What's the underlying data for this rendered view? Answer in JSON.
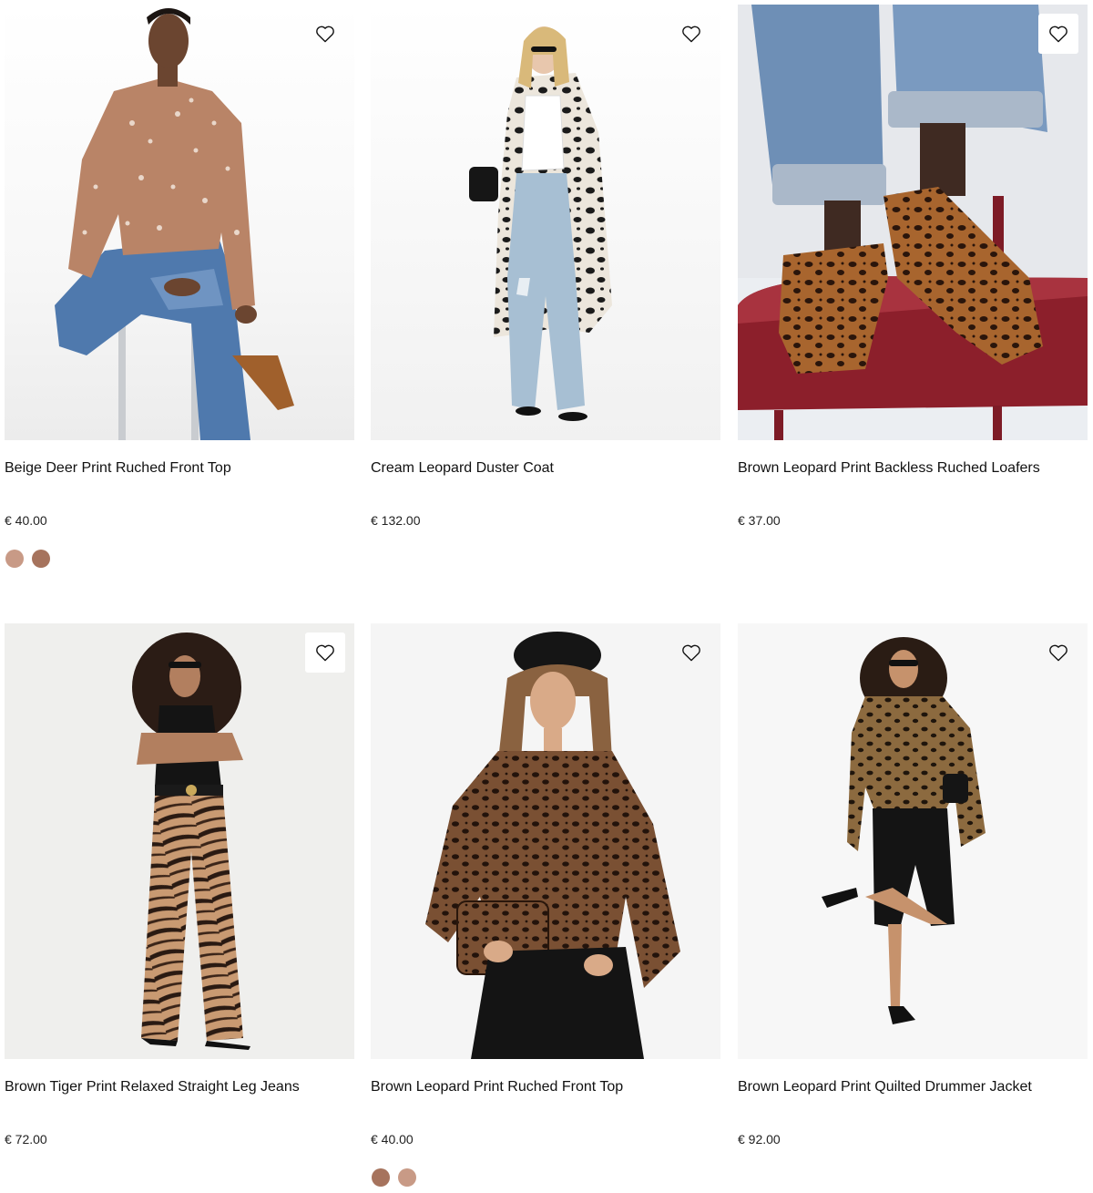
{
  "products": [
    {
      "title": "Beige Deer Print Ruched Front Top",
      "price": "€ 40.00",
      "swatches": [
        {
          "name": "swatch-light",
          "color": "#c89a86"
        },
        {
          "name": "swatch-dark",
          "color": "#a6735d"
        }
      ]
    },
    {
      "title": "Cream Leopard Duster Coat",
      "price": "€ 132.00",
      "swatches": []
    },
    {
      "title": "Brown Leopard Print Backless Ruched Loafers",
      "price": "€ 37.00",
      "swatches": []
    },
    {
      "title": "Brown Tiger Print Relaxed Straight Leg Jeans",
      "price": "€ 72.00",
      "swatches": []
    },
    {
      "title": "Brown Leopard Print Ruched Front Top",
      "price": "€ 40.00",
      "swatches": [
        {
          "name": "swatch-dark",
          "color": "#a6735d"
        },
        {
          "name": "swatch-light",
          "color": "#c89a86"
        }
      ]
    },
    {
      "title": "Brown Leopard Print Quilted Drummer Jacket",
      "price": "€ 92.00",
      "swatches": []
    }
  ],
  "icons": {
    "wishlist": "heart-icon"
  }
}
